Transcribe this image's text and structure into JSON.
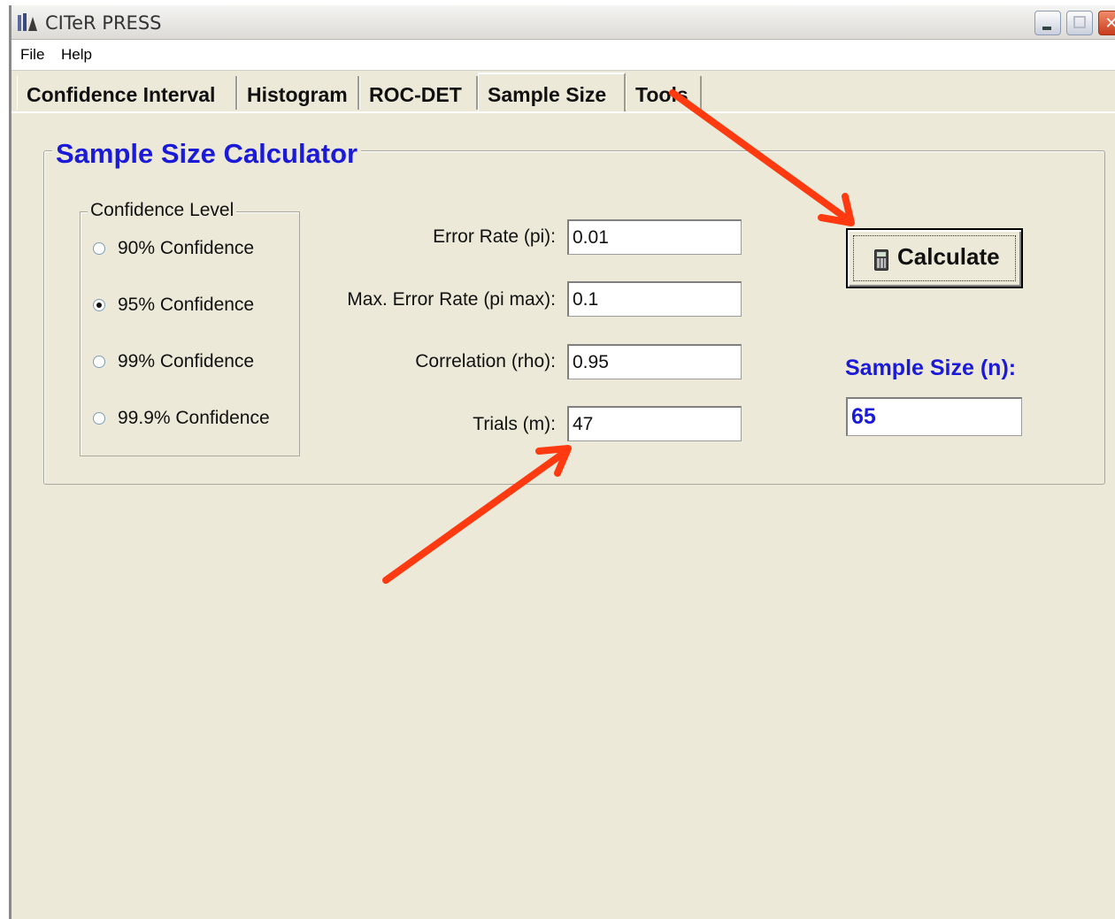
{
  "window": {
    "title": "CITeR PRESS",
    "controls": {
      "minimize_icon": "minimize-icon",
      "maximize_icon": "maximize-icon",
      "close_icon": "close-icon"
    }
  },
  "menu": {
    "items": [
      "File",
      "Help"
    ]
  },
  "tabs": [
    {
      "label": "Confidence Interval",
      "active": false
    },
    {
      "label": "Histogram",
      "active": false
    },
    {
      "label": "ROC-DET",
      "active": false
    },
    {
      "label": "Sample Size",
      "active": true
    },
    {
      "label": "Tools",
      "active": false
    }
  ],
  "calculator": {
    "title": "Sample Size Calculator",
    "confidence": {
      "title": "Confidence Level",
      "options": [
        {
          "label": "90% Confidence",
          "checked": false
        },
        {
          "label": "95% Confidence",
          "checked": true
        },
        {
          "label": "99% Confidence",
          "checked": false
        },
        {
          "label": "99.9% Confidence",
          "checked": false
        }
      ]
    },
    "fields": [
      {
        "label": "Error Rate (pi):",
        "value": "0.01"
      },
      {
        "label": "Max. Error Rate (pi max):",
        "value": "0.1"
      },
      {
        "label": "Correlation (rho):",
        "value": "0.95"
      },
      {
        "label": "Trials (m):",
        "value": "47"
      }
    ],
    "calculate_label": "Calculate",
    "calculate_icon": "calculator-icon",
    "result": {
      "label": "Sample Size (n):",
      "value": "65"
    }
  },
  "colors": {
    "accent_blue": "#1a1ad8",
    "annotation_arrow": "#ff3a10",
    "background": "#ece9d8"
  }
}
